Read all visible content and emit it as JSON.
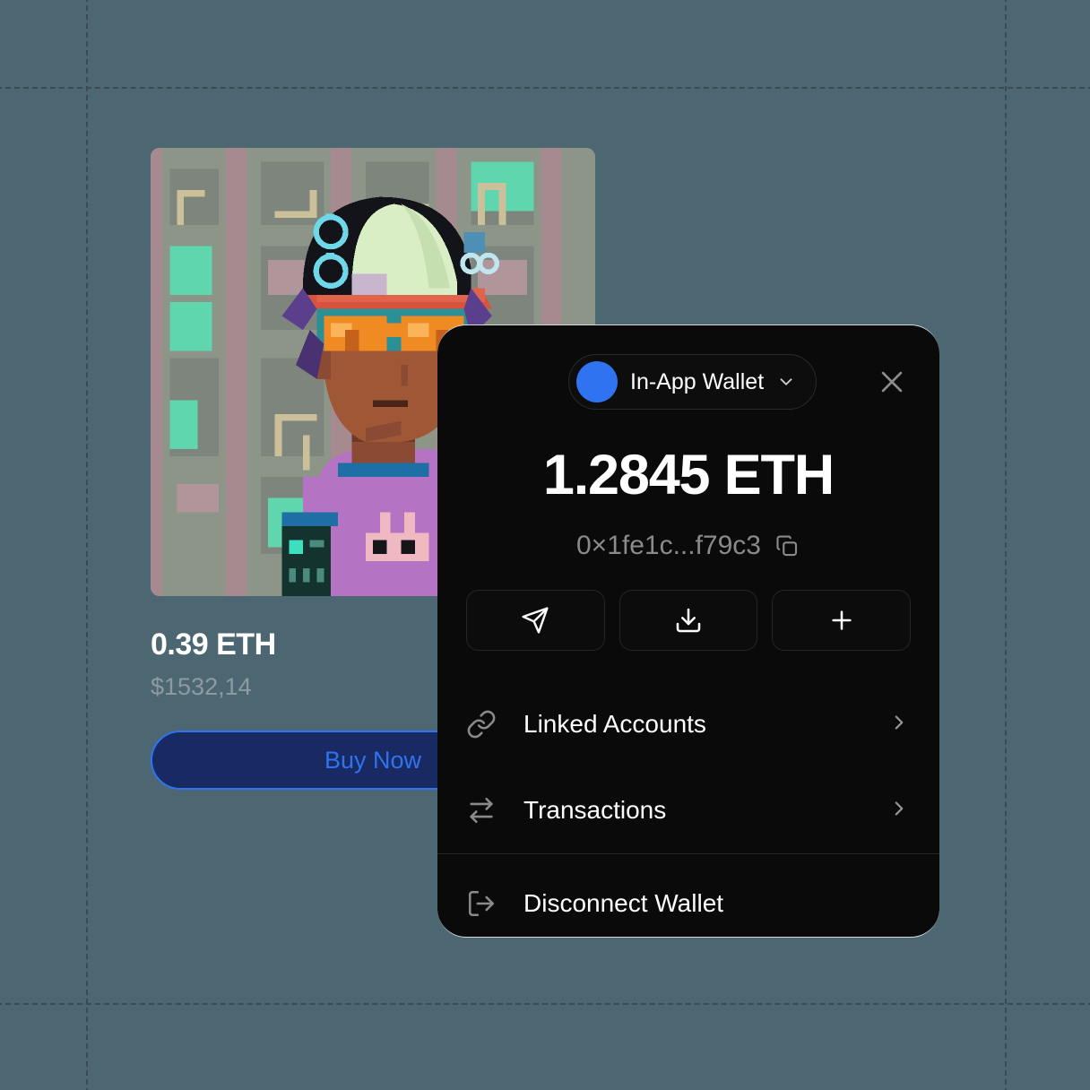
{
  "canvas": {
    "background_color": "#4c6771",
    "grid_line_color": "#3a4b52",
    "grid_vertical_positions": [
      96,
      1121
    ],
    "grid_horizontal_positions": [
      97,
      1119
    ]
  },
  "nft_card": {
    "image_alt": "pixel-art-avatar-nft",
    "price": "0.39 ETH",
    "fiat_price": "$1532,14",
    "buy_button_label": "Buy Now",
    "buy_button_text_color": "#2f73f0",
    "buy_button_fill_color": "#182a61"
  },
  "wallet_modal": {
    "background_color": "#0a0a0a",
    "selector": {
      "avatar_color": "#2f73f0",
      "label": "In-App Wallet",
      "chevron_icon": "chevron-down-icon"
    },
    "close_icon": "close-icon",
    "balance": "1.2845 ETH",
    "address": "0×1fe1c...f79c3",
    "copy_icon": "copy-icon",
    "actions": [
      {
        "name": "send",
        "icon": "send-icon"
      },
      {
        "name": "receive",
        "icon": "download-icon"
      },
      {
        "name": "buy",
        "icon": "plus-icon"
      }
    ],
    "menu_items": [
      {
        "label": "Linked Accounts",
        "icon": "link-icon",
        "chevron": "chevron-right-icon"
      },
      {
        "label": "Transactions",
        "icon": "swap-arrows-icon",
        "chevron": "chevron-right-icon"
      }
    ],
    "disconnect": {
      "label": "Disconnect Wallet",
      "icon": "logout-icon"
    }
  }
}
